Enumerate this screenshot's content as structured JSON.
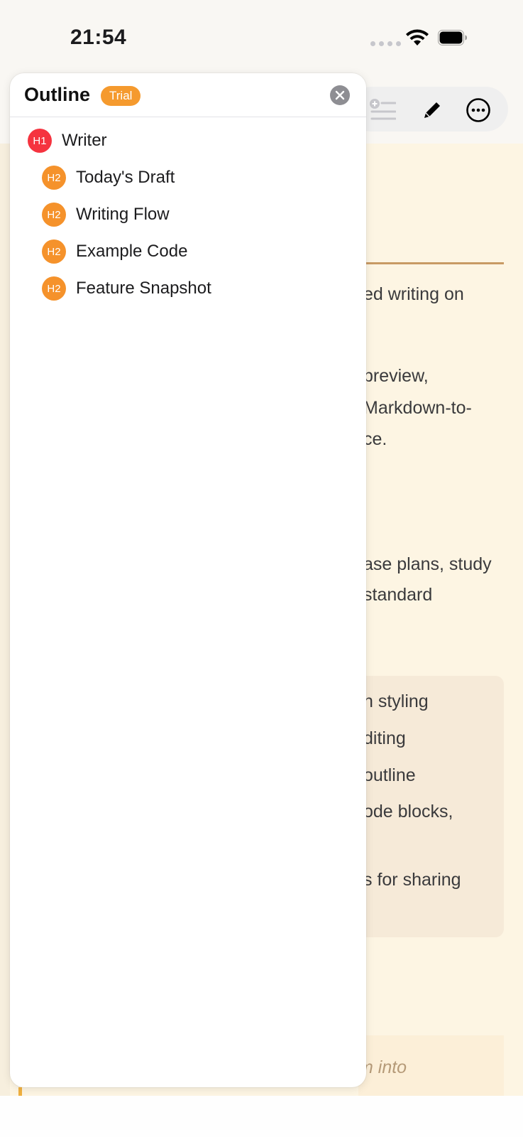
{
  "status_bar": {
    "time": "21:54",
    "icons": [
      "cellular-icon",
      "wifi-icon",
      "battery-icon"
    ]
  },
  "toolbar": {
    "buttons": [
      "add-heading-icon",
      "pencil-icon",
      "more-icon"
    ]
  },
  "outline_panel": {
    "title": "Outline",
    "badge": "Trial",
    "items": [
      {
        "level": "H1",
        "label": "Writer"
      },
      {
        "level": "H2",
        "label": "Today's Draft"
      },
      {
        "level": "H2",
        "label": "Writing Flow"
      },
      {
        "level": "H2",
        "label": "Example Code"
      },
      {
        "level": "H2",
        "label": "Feature Snapshot"
      }
    ]
  },
  "document_fragments": [
    "ed writing on",
    "preview,",
    "Markdown-to-",
    "ce.",
    "ase plans, study",
    "standard",
    "n styling",
    "diting",
    "outline",
    "ode blocks,",
    "s for sharing",
    "m into"
  ],
  "colors": {
    "h1_badge": "#f5333f",
    "h2_badge": "#f5922b",
    "trial_badge": "#f59a2e",
    "document_bg": "#fdf5e3"
  }
}
